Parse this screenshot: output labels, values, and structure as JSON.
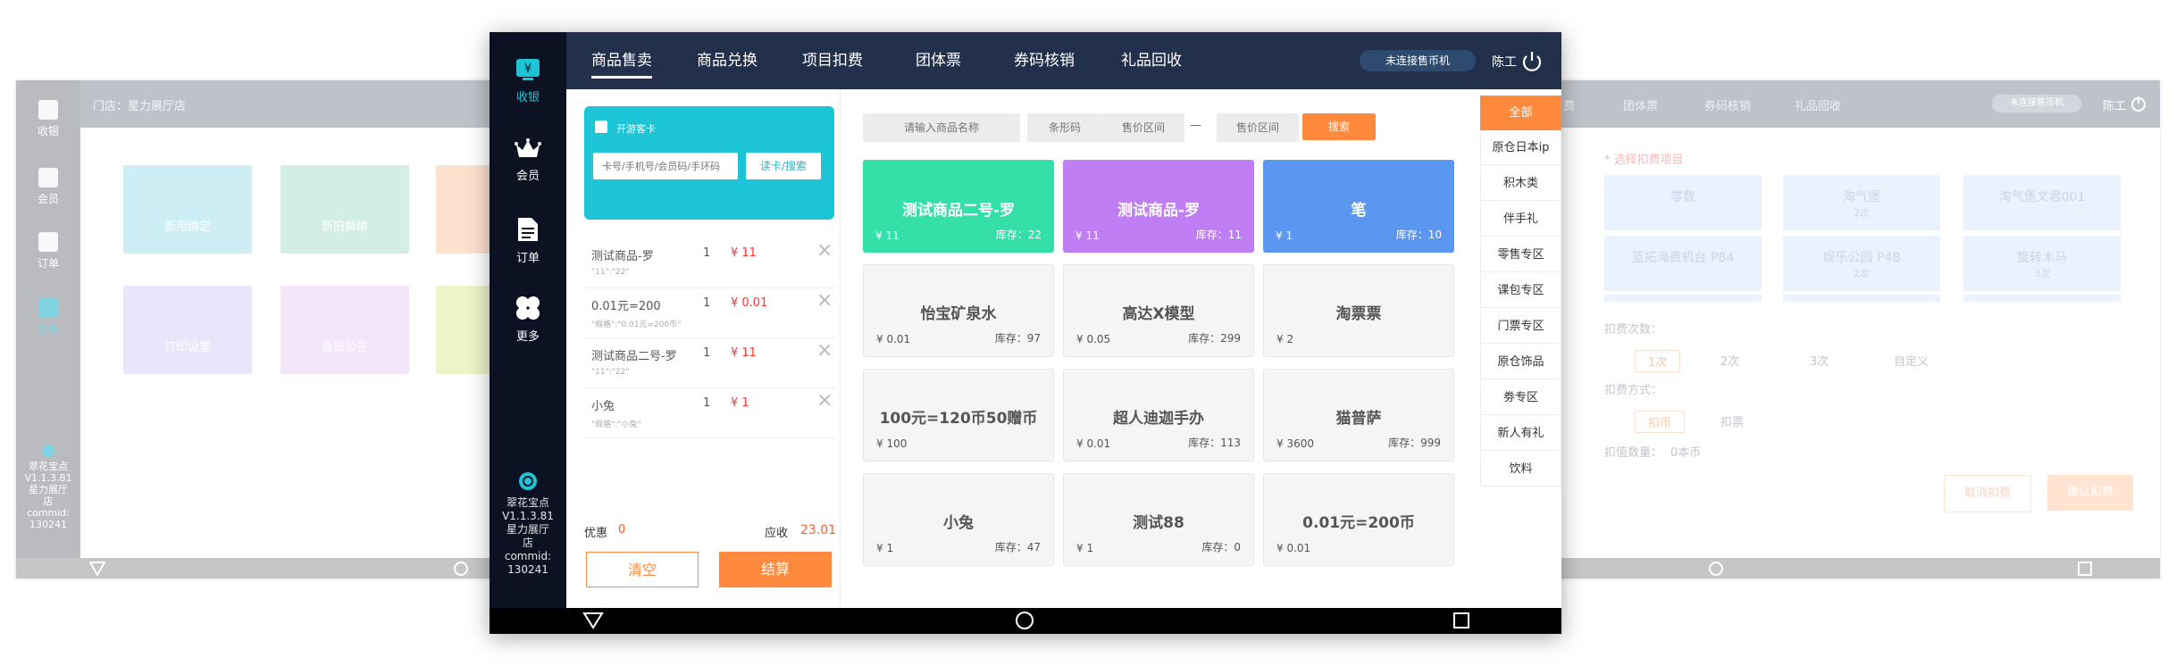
{
  "background_left": {
    "store_label": "门店：星力展厅店",
    "sidebar": [
      {
        "label": "收银",
        "icon": "cashier-icon"
      },
      {
        "label": "会员",
        "icon": "crown-icon"
      },
      {
        "label": "订单",
        "icon": "document-icon"
      },
      {
        "label": "更多",
        "icon": "grid-icon"
      }
    ],
    "version_lines": [
      "翠花宝点",
      "V1.1.3.81",
      "星力展厅",
      "店",
      "commid:",
      "130241"
    ],
    "tiles": [
      {
        "label": "新用绑定",
        "color": "#cdeef5"
      },
      {
        "label": "新旧解绑",
        "color": "#d3efe4"
      },
      {
        "label": "打印设置",
        "color": "#e7e6fb"
      },
      {
        "label": "会员公告",
        "color": "#f4e6fa"
      }
    ]
  },
  "background_right": {
    "tabs": [
      "费",
      "团体票",
      "券码核销",
      "礼品回收"
    ],
    "status_pill": "未连接售币机",
    "user": "陈工",
    "section_label": "* 选择扣费项目",
    "options": [
      {
        "name": "零数",
        "sub": ""
      },
      {
        "name": "淘气堡",
        "sub": "2次"
      },
      {
        "name": "淘气堡文君001",
        "sub": ""
      },
      {
        "name": "蓝拓海费机台 P84",
        "sub": ""
      },
      {
        "name": "娱乐公园 P48",
        "sub": "2次"
      },
      {
        "name": "旋转木马",
        "sub": "3次"
      }
    ],
    "deduct_count_label": "扣费次数：",
    "deduct_counts": [
      "1次",
      "2次",
      "3次",
      "自定义"
    ],
    "deduct_method_label": "扣费方式：",
    "deduct_methods": [
      "扣币",
      "扣票"
    ],
    "deduct_amount_label": "扣值数量：",
    "deduct_amount_value": "0本币",
    "cancel_button": "取消扣费",
    "confirm_button": "确认扣费"
  },
  "main": {
    "sidebar": {
      "items": [
        {
          "label": "收银",
          "icon": "cashier-icon"
        },
        {
          "label": "会员",
          "icon": "crown-icon"
        },
        {
          "label": "订单",
          "icon": "document-icon"
        },
        {
          "label": "更多",
          "icon": "clover-icon"
        }
      ],
      "version_lines": [
        "翠花宝点",
        "V1.1.3.81",
        "星力展厅",
        "店",
        "commid:",
        "130241"
      ]
    },
    "tabs": [
      "商品售卖",
      "商品兑换",
      "项目扣费",
      "团体票",
      "券码核销",
      "礼品回收"
    ],
    "active_tab": "商品售卖",
    "status_pill": "未连接售币机",
    "user": "陈工",
    "member_panel": {
      "checkbox_label": "开游客卡",
      "input_placeholder": "卡号/手机号/会员码/手环码",
      "read_button": "读卡/搜索"
    },
    "cart": [
      {
        "name": "测试商品-罗",
        "spec": "\"11\":\"22\"",
        "qty": "1",
        "price": "¥ 11"
      },
      {
        "name": "0.01元=200",
        "spec": "\"规格\":\"0.01元=200币\"",
        "qty": "1",
        "price": "¥ 0.01"
      },
      {
        "name": "测试商品二号-罗",
        "spec": "\"11\":\"22\"",
        "qty": "1",
        "price": "¥ 11"
      },
      {
        "name": "小兔",
        "spec": "\"规格\":\"小兔\"",
        "qty": "1",
        "price": "¥ 1"
      }
    ],
    "discount_label": "优惠",
    "discount_value": "0",
    "due_label": "应收",
    "due_value": "23.01",
    "clear_button": "清空",
    "checkout_button": "结算",
    "filters": {
      "name_placeholder": "请输入商品名称",
      "barcode_placeholder": "条形码",
      "price_min_placeholder": "售价区间",
      "dash": "—",
      "price_max_placeholder": "售价区间",
      "search_button": "搜索"
    },
    "products": [
      {
        "name": "测试商品二号-罗",
        "price": "¥ 11",
        "stock": "库存：22",
        "color": "#35e0a8"
      },
      {
        "name": "测试商品-罗",
        "price": "¥ 11",
        "stock": "库存：11",
        "color": "#c07ef4"
      },
      {
        "name": "笔",
        "price": "¥ 1",
        "stock": "库存：10",
        "color": "#5b97f0"
      },
      {
        "name": "怡宝矿泉水",
        "price": "¥ 0.01",
        "stock": "库存：97",
        "color": ""
      },
      {
        "name": "高达X模型",
        "price": "¥ 0.05",
        "stock": "库存：299",
        "color": ""
      },
      {
        "name": "淘票票",
        "price": "¥ 2",
        "stock": "",
        "color": ""
      },
      {
        "name": "100元=120币50赠币",
        "price": "¥ 100",
        "stock": "",
        "color": ""
      },
      {
        "name": "超人迪迦手办",
        "price": "¥ 0.01",
        "stock": "库存：113",
        "color": ""
      },
      {
        "name": "猫普萨",
        "price": "¥ 3600",
        "stock": "库存：999",
        "color": ""
      },
      {
        "name": "小兔",
        "price": "¥ 1",
        "stock": "库存：47",
        "color": ""
      },
      {
        "name": "测试88",
        "price": "¥ 1",
        "stock": "库存：0",
        "color": ""
      },
      {
        "name": "0.01元=200币",
        "price": "¥ 0.01",
        "stock": "",
        "color": ""
      }
    ],
    "categories": [
      "全部",
      "原仓日本ip",
      "积木类",
      "伴手礼",
      "零售专区",
      "课包专区",
      "门票专区",
      "原仓饰品",
      "劵专区",
      "新人有礼",
      "饮料"
    ],
    "active_category": "全部",
    "colors": {
      "accent": "#ff8a3d",
      "topbar": "#22304c",
      "sidebar": "#0d1222",
      "cyan": "#1cc4d6",
      "price_red": "#ff3b30"
    }
  }
}
